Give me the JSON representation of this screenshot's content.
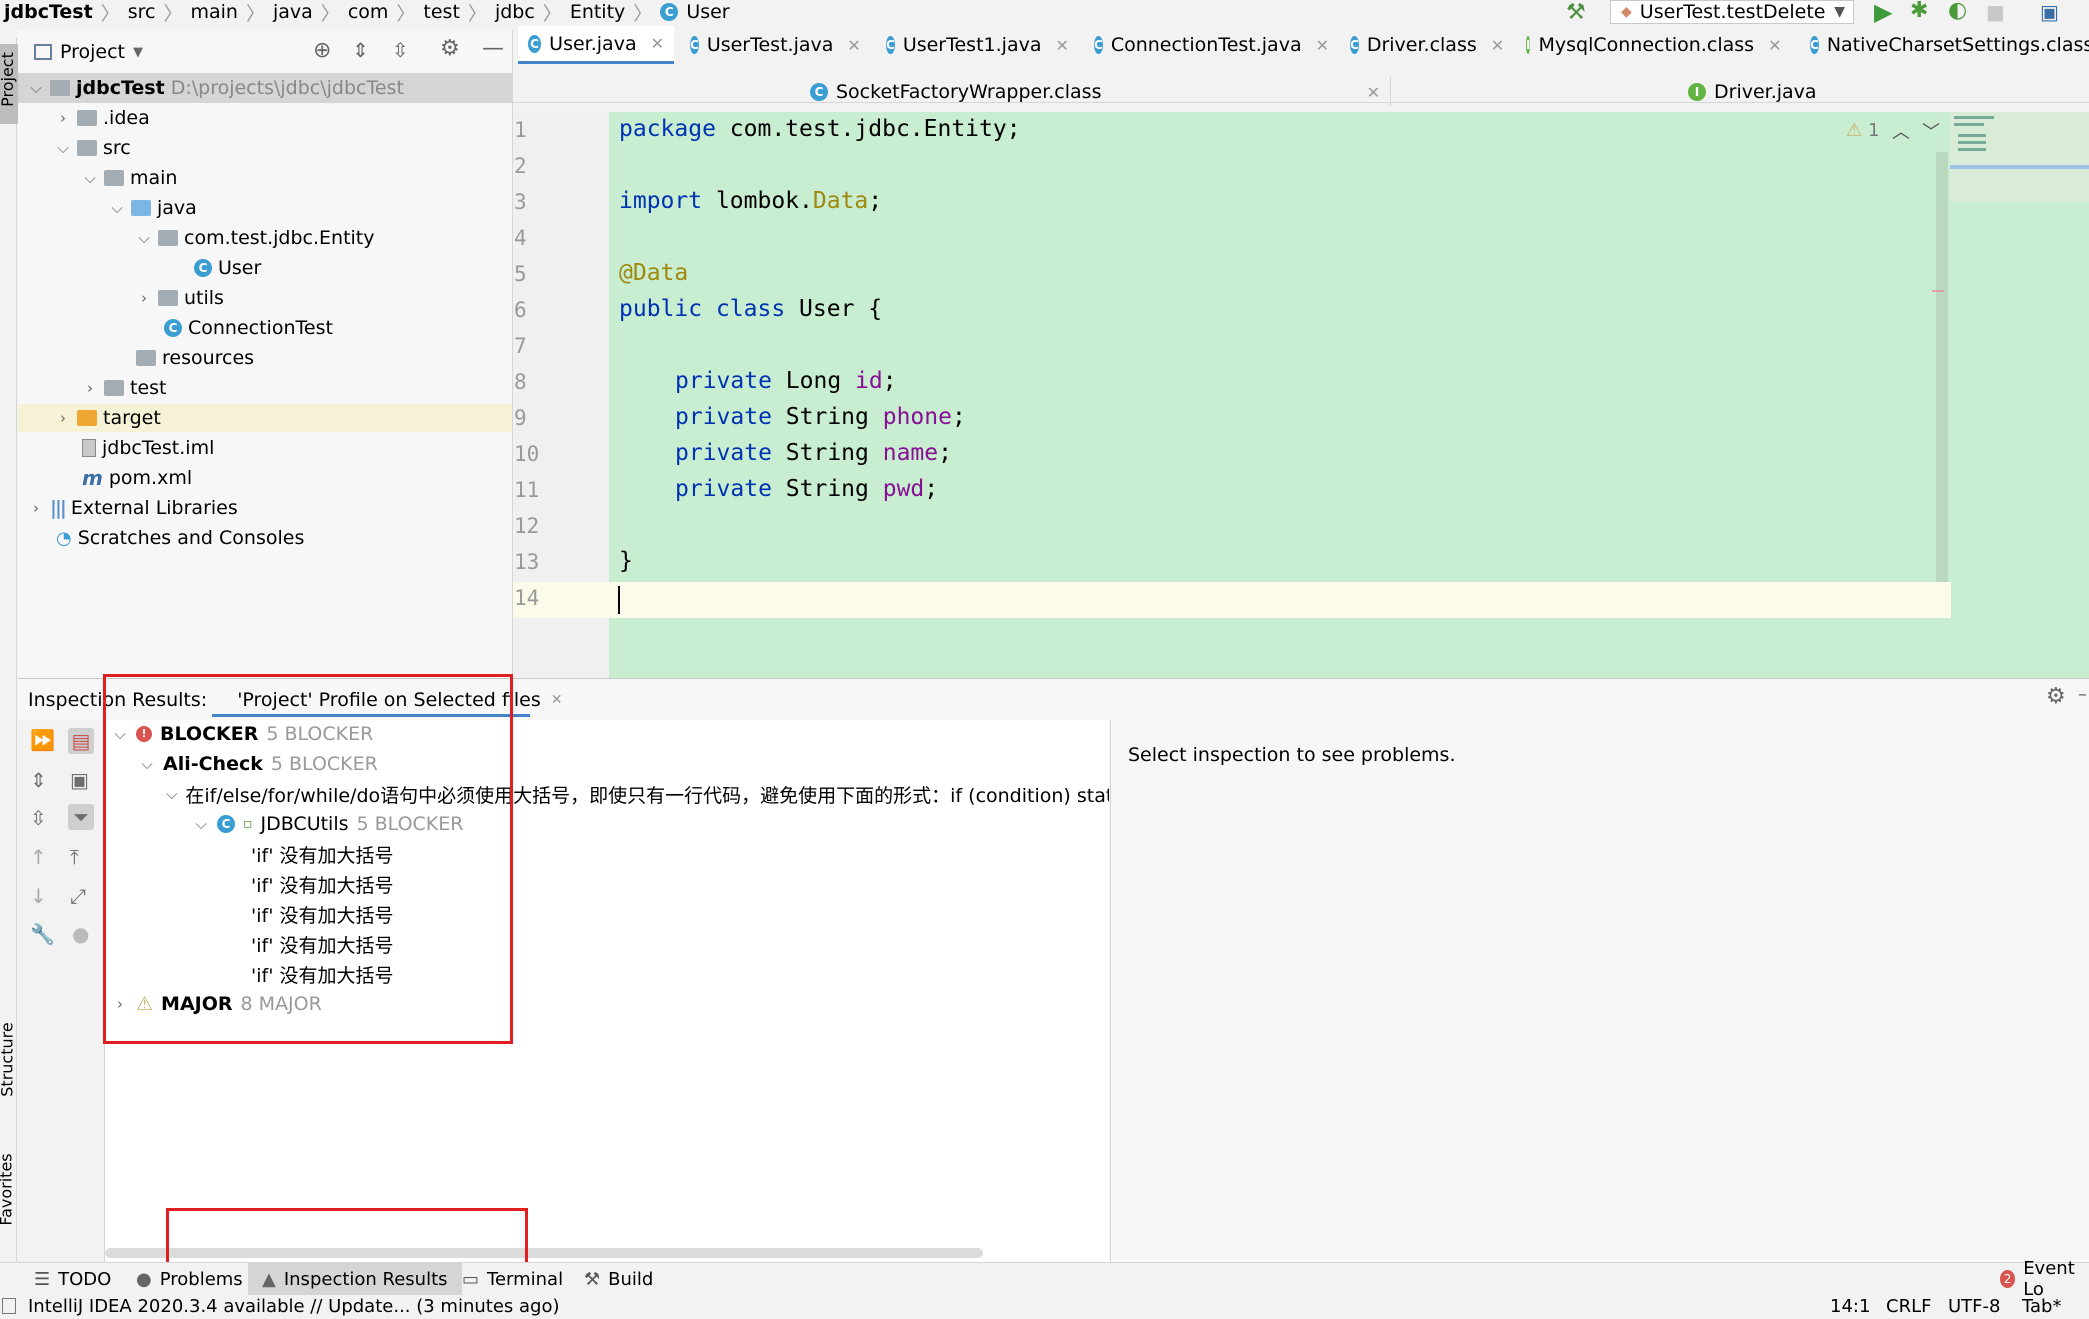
{
  "breadcrumb": [
    "jdbcTest",
    "src",
    "main",
    "java",
    "com",
    "test",
    "jdbc",
    "Entity",
    "User"
  ],
  "run_config": {
    "label": "UserTest.testDelete"
  },
  "project_panel": {
    "title": "Project",
    "tree": [
      {
        "label": "jdbcTest",
        "extra": "D:\\projects\\jdbc\\jdbcTest"
      },
      {
        "label": ".idea"
      },
      {
        "label": "src"
      },
      {
        "label": "main"
      },
      {
        "label": "java"
      },
      {
        "label": "com.test.jdbc.Entity"
      },
      {
        "label": "User"
      },
      {
        "label": "utils"
      },
      {
        "label": "ConnectionTest"
      },
      {
        "label": "resources"
      },
      {
        "label": "test"
      },
      {
        "label": "target"
      },
      {
        "label": "jdbcTest.iml"
      },
      {
        "label": "pom.xml"
      },
      {
        "label": "External Libraries"
      },
      {
        "label": "Scratches and Consoles"
      }
    ]
  },
  "editor_tabs": [
    {
      "label": "User.java",
      "active": true
    },
    {
      "label": "UserTest.java"
    },
    {
      "label": "UserTest1.java"
    },
    {
      "label": "ConnectionTest.java"
    },
    {
      "label": "Driver.class"
    },
    {
      "label": "MysqlConnection.class"
    },
    {
      "label": "NativeCharsetSettings.class"
    }
  ],
  "editor_tabs_row2": [
    {
      "label": "SocketFactoryWrapper.class"
    },
    {
      "label": "Driver.java"
    }
  ],
  "editor": {
    "warnings": "1",
    "line_numbers": [
      "1",
      "2",
      "3",
      "4",
      "5",
      "6",
      "7",
      "8",
      "9",
      "10",
      "11",
      "12",
      "13",
      "14"
    ],
    "lines": {
      "l1_kw": "package",
      "l1_rest": " com.test.jdbc.Entity;",
      "l3_kw": "import",
      "l3_pkg": " lombok.",
      "l3_cls": "Data",
      "l3_end": ";",
      "l5_ann": "@Data",
      "l6_kw1": "public",
      "l6_kw2": " class",
      "l6_rest": " User {",
      "l8_kw": "private",
      "l8_type": " Long ",
      "l8_fld": "id",
      "l8_end": ";",
      "l9_kw": "private",
      "l9_type": " String ",
      "l9_fld": "phone",
      "l9_end": ";",
      "l10_kw": "private",
      "l10_type": " String ",
      "l10_fld": "name",
      "l10_end": ";",
      "l11_kw": "private",
      "l11_type": " String ",
      "l11_fld": "pwd",
      "l11_end": ";",
      "l13": "}"
    }
  },
  "inspection": {
    "header_label": "Inspection Results:",
    "tab_label": "'Project' Profile on Selected files",
    "blocker": {
      "label": "BLOCKER",
      "count": "5 BLOCKER"
    },
    "alicheck": {
      "label": "Ali-Check",
      "count": "5 BLOCKER"
    },
    "rule": "在if/else/for/while/do语句中必须使用大括号，即使只有一行代码，避免使用下面的形式：if (condition) stateme",
    "jdbc": {
      "label": "JDBCUtils",
      "count": "5 BLOCKER"
    },
    "problems": [
      "'if' 没有加大括号",
      "'if' 没有加大括号",
      "'if' 没有加大括号",
      "'if' 没有加大括号",
      "'if' 没有加大括号"
    ],
    "major": {
      "label": "MAJOR",
      "count": "8 MAJOR"
    },
    "detail_text": "Select inspection to see problems."
  },
  "side_labels": {
    "project": "Project",
    "structure": "Structure",
    "favorites": "Favorites"
  },
  "bottom_tabs": {
    "todo": "TODO",
    "problems": "Problems",
    "inspection": "Inspection Results",
    "terminal": "Terminal",
    "build": "Build",
    "event_count": "2",
    "event": "Event Lo"
  },
  "status": {
    "message": "IntelliJ IDEA 2020.3.4 available // Update... (3 minutes ago)",
    "position": "14:1",
    "line_sep": "CRLF",
    "encoding": "UTF-8",
    "indent": "Tab*"
  },
  "colors": {
    "editor_bg": "#c8edd0",
    "highlight": "#e02020"
  }
}
